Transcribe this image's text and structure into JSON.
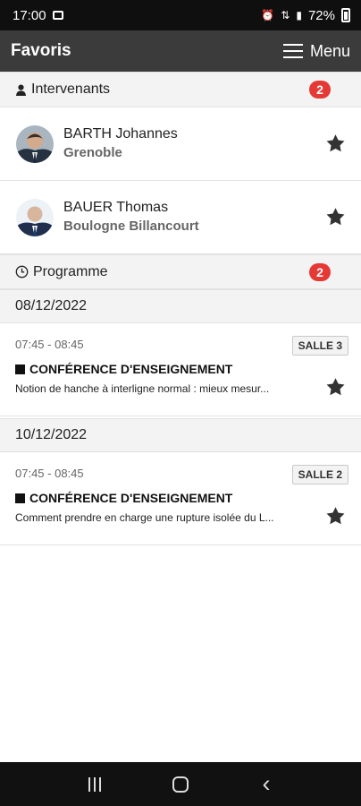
{
  "status_bar": {
    "time": "17:00",
    "battery_percent": "72%",
    "icons": [
      "photo-icon",
      "alarm-icon",
      "sync-icon",
      "signal-icon",
      "battery-icon"
    ]
  },
  "header": {
    "title": "Favoris",
    "menu_label": "Menu"
  },
  "intervenants": {
    "title": "Intervenants",
    "count": "2",
    "people": [
      {
        "name": "BARTH Johannes",
        "city": "Grenoble"
      },
      {
        "name": "BAUER Thomas",
        "city": "Boulogne Billancourt"
      }
    ]
  },
  "programme": {
    "title": "Programme",
    "count": "2",
    "groups": [
      {
        "date": "08/12/2022",
        "session": {
          "time": "07:45 - 08:45",
          "room": "SALLE 3",
          "type": "CONFÉRENCE D'ENSEIGNEMENT",
          "description": "Notion de hanche à interligne normal : mieux mesur..."
        }
      },
      {
        "date": "10/12/2022",
        "session": {
          "time": "07:45 - 08:45",
          "room": "SALLE 2",
          "type": "CONFÉRENCE D'ENSEIGNEMENT",
          "description": "Comment prendre en charge une rupture isolée du L..."
        }
      }
    ]
  },
  "colors": {
    "header": "#3b3b3b",
    "section_bg": "#f3f3f3",
    "badge": "#e53935",
    "star": "#333333"
  }
}
